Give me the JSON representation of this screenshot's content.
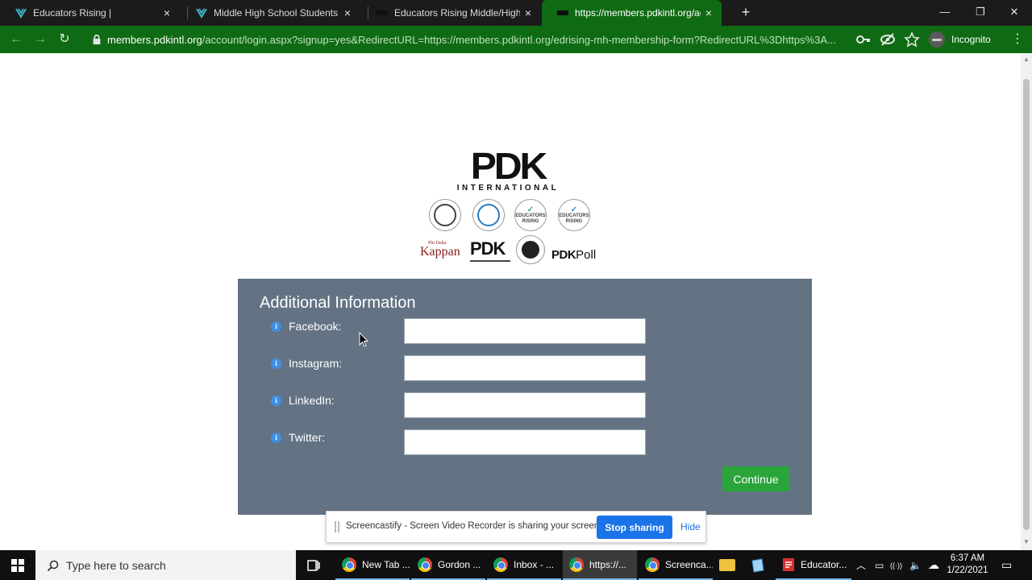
{
  "browser": {
    "tabs": [
      {
        "title": "Educators Rising |",
        "active": false
      },
      {
        "title": "Middle High School Students | Ed",
        "active": false
      },
      {
        "title": "Educators Rising Middle/High Sc",
        "active": false
      },
      {
        "title": "https://members.pdkintl.org/acc",
        "active": true
      }
    ],
    "new_tab_label": "+",
    "close_glyph": "×",
    "window_controls": {
      "minimize": "—",
      "restore": "❐",
      "close": "✕"
    },
    "address": {
      "host": "members.pdkintl.org",
      "path": "/account/login.aspx?signup=yes&RedirectURL=https://members.pdkintl.org/edrising-mh-membership-form?RedirectURL%3Dhttps%3A..."
    },
    "profile_label": "Incognito",
    "nav_glyphs": {
      "back": "←",
      "forward": "→",
      "reload": "↻"
    },
    "toolbar_icons": [
      "key-icon",
      "eye-off-icon",
      "star-icon"
    ]
  },
  "page": {
    "logo": {
      "main": "PDK",
      "sub": "INTERNATIONAL"
    },
    "sub_logos": {
      "seal_er_1": "EDUCATORS RISING",
      "seal_er_2": "EDUCATORS RISING",
      "kappan_small": "Phi Delta",
      "kappan": "Kappan",
      "pdk_mark": "PDK",
      "pdk_poll_bold": "PDK",
      "pdk_poll_rest": "Poll"
    },
    "form": {
      "title": "Additional Information",
      "fields": [
        {
          "label": "Facebook:",
          "value": ""
        },
        {
          "label": "Instagram:",
          "value": ""
        },
        {
          "label": "LinkedIn:",
          "value": ""
        },
        {
          "label": "Twitter:",
          "value": ""
        }
      ],
      "info_glyph": "i",
      "continue_label": "Continue"
    },
    "accent_colors": {
      "panel": "#637384",
      "continue": "#2aa53a",
      "browser": "#0f6b13"
    }
  },
  "screencastify": {
    "message": "Screencastify - Screen Video Recorder is sharing your screen.",
    "stop_label": "Stop sharing",
    "hide_label": "Hide"
  },
  "taskbar": {
    "search_placeholder": "Type here to search",
    "apps": [
      {
        "label": "New Tab ...",
        "active": false
      },
      {
        "label": "Gordon ...",
        "active": false
      },
      {
        "label": "Inbox - ...",
        "active": false
      },
      {
        "label": "https://...",
        "active": true
      },
      {
        "label": "Screenca...",
        "active": false
      }
    ],
    "pdf_app_label": "Educator...",
    "tray_glyphs": {
      "chevron": "︿",
      "battery": "▭",
      "wifi": "((·))",
      "volume": "🔈",
      "cloud": "☁"
    },
    "time": "6:37 AM",
    "date": "1/22/2021",
    "notification_glyph": "▭"
  }
}
